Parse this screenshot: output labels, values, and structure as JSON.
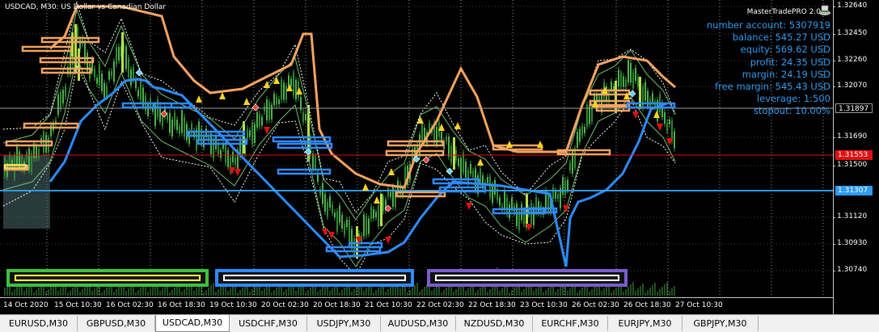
{
  "window": {
    "title": "USDCAD, M30:  US Dollar vs Canadian Dollar",
    "ea_name": "MasterTradePRO 2.0"
  },
  "colors": {
    "background": "#000000",
    "candle": "#3fa03f",
    "upper_band": "#f4a460",
    "lower_band": "#2e8bff",
    "ask_line": "#e01010",
    "support_line": "#2e9bf0",
    "info_text": "#2e9bf0",
    "box_green": "#3ec13e",
    "box_blue": "#2e8bff",
    "box_purple": "#7a5ccc"
  },
  "account_info": [
    "number account: 5307919",
    "balance: 545.27 USD",
    "equity: 569.62 USD",
    "profit: 24.35 USD",
    "margin: 24.19 USD",
    "free margin: 545.43 USD",
    "leverage: 1:500",
    "stopout: 10.00%"
  ],
  "price_axis": {
    "ticks": [
      "1.32640",
      "1.32450",
      "1.32260",
      "1.32070",
      "1.31897",
      "1.31690",
      "1.31500",
      "1.31307",
      "1.31120",
      "1.30930",
      "1.30740"
    ],
    "current_price": "1.31553",
    "level_price": "1.31307"
  },
  "time_axis": {
    "ticks": [
      "14 Oct 2020",
      "15 Oct 10:30",
      "16 Oct 02:30",
      "16 Oct 18:30",
      "19 Oct 10:30",
      "20 Oct 02:30",
      "20 Oct 18:30",
      "21 Oct 10:30",
      "22 Oct 02:30",
      "22 Oct 18:30",
      "23 Oct 10:30",
      "26 Oct 02:30",
      "26 Oct 18:30",
      "27 Oct 10:30"
    ]
  },
  "tabs": [
    {
      "label": "EURUSD,M30"
    },
    {
      "label": "GBPUSD,M30"
    },
    {
      "label": "USDCAD,M30",
      "active": true
    },
    {
      "label": "USDCHF,M30"
    },
    {
      "label": "USDJPY,M30"
    },
    {
      "label": "AUDUSD,M30"
    },
    {
      "label": "NZDUSD,M30"
    },
    {
      "label": "EURCHF,M30"
    },
    {
      "label": "EURJPY,M30"
    },
    {
      "label": "GBPJPY,M30"
    }
  ]
}
